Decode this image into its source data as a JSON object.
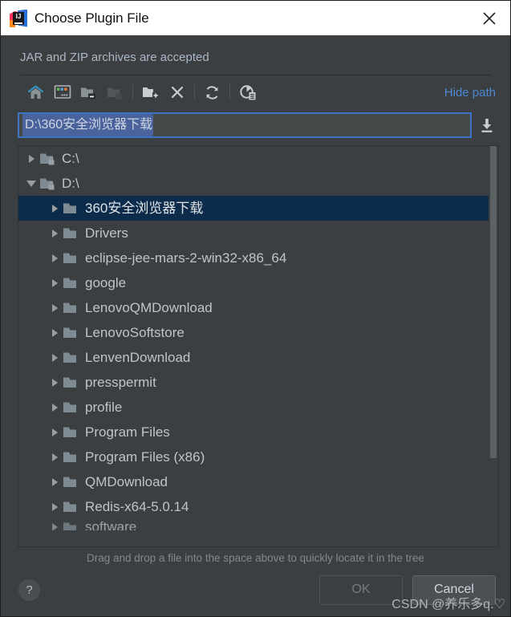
{
  "window": {
    "title": "Choose Plugin File",
    "app_icon": "intellij-idea-icon",
    "close_icon": "close-icon",
    "subtitle": "JAR and ZIP archives are accepted"
  },
  "toolbar": {
    "items": [
      {
        "name": "home-icon",
        "tooltip": "Home",
        "disabled": false
      },
      {
        "name": "desktop-icon",
        "tooltip": "Desktop",
        "disabled": false
      },
      {
        "name": "collapse-folder-icon",
        "tooltip": "Collapse",
        "disabled": false
      },
      {
        "name": "expand-folder-icon",
        "tooltip": "Expand",
        "disabled": true
      },
      {
        "name": "new-folder-icon",
        "tooltip": "New Folder",
        "disabled": false
      },
      {
        "name": "delete-icon",
        "tooltip": "Delete",
        "disabled": false
      },
      {
        "name": "refresh-icon",
        "tooltip": "Refresh",
        "disabled": false
      },
      {
        "name": "show-hidden-files-icon",
        "tooltip": "Show Hidden Files",
        "disabled": false
      }
    ],
    "hide_path_label": "Hide path"
  },
  "path_field": {
    "value": "D:\\360安全浏览器下载",
    "placeholder": "",
    "selected": true,
    "download_icon": "download-arrow-icon"
  },
  "tree": {
    "rows": [
      {
        "label": "C:\\",
        "level": 1,
        "expanded": false,
        "selected": false,
        "icon": "locked-drive-folder-icon",
        "clipped": false
      },
      {
        "label": "D:\\",
        "level": 1,
        "expanded": true,
        "selected": false,
        "icon": "locked-drive-folder-icon",
        "clipped": false
      },
      {
        "label": "360安全浏览器下载",
        "level": 2,
        "expanded": false,
        "selected": true,
        "icon": "folder-icon",
        "clipped": false
      },
      {
        "label": "Drivers",
        "level": 2,
        "expanded": false,
        "selected": false,
        "icon": "folder-icon",
        "clipped": false
      },
      {
        "label": "eclipse-jee-mars-2-win32-x86_64",
        "level": 2,
        "expanded": false,
        "selected": false,
        "icon": "folder-icon",
        "clipped": false
      },
      {
        "label": "google",
        "level": 2,
        "expanded": false,
        "selected": false,
        "icon": "folder-icon",
        "clipped": false
      },
      {
        "label": "LenovoQMDownload",
        "level": 2,
        "expanded": false,
        "selected": false,
        "icon": "folder-icon",
        "clipped": false
      },
      {
        "label": "LenovoSoftstore",
        "level": 2,
        "expanded": false,
        "selected": false,
        "icon": "folder-icon",
        "clipped": false
      },
      {
        "label": "LenvenDownload",
        "level": 2,
        "expanded": false,
        "selected": false,
        "icon": "folder-icon",
        "clipped": false
      },
      {
        "label": "presspermit",
        "level": 2,
        "expanded": false,
        "selected": false,
        "icon": "folder-icon",
        "clipped": false
      },
      {
        "label": "profile",
        "level": 2,
        "expanded": false,
        "selected": false,
        "icon": "folder-icon",
        "clipped": false
      },
      {
        "label": "Program Files",
        "level": 2,
        "expanded": false,
        "selected": false,
        "icon": "folder-icon",
        "clipped": false
      },
      {
        "label": "Program Files (x86)",
        "level": 2,
        "expanded": false,
        "selected": false,
        "icon": "folder-icon",
        "clipped": false
      },
      {
        "label": "QMDownload",
        "level": 2,
        "expanded": false,
        "selected": false,
        "icon": "folder-icon",
        "clipped": false
      },
      {
        "label": "Redis-x64-5.0.14",
        "level": 2,
        "expanded": false,
        "selected": false,
        "icon": "folder-icon",
        "clipped": false
      },
      {
        "label": "software",
        "level": 2,
        "expanded": false,
        "selected": false,
        "icon": "folder-icon",
        "clipped": true
      }
    ],
    "scrollbar": {
      "name": "vertical-scrollbar",
      "thumb_top_pct": 0,
      "thumb_height_pct": 78
    }
  },
  "hint": "Drag and drop a file into the space above to quickly locate it in the tree",
  "buttons": {
    "help_label": "?",
    "ok_label": "OK",
    "ok_disabled": true,
    "cancel_label": "Cancel"
  },
  "watermark": "CSDN @养乐多q.♡",
  "colors": {
    "dialog_bg": "#3c3f41",
    "titlebar_bg": "#ffffff",
    "accent_link": "#4d88d4",
    "selection_row": "#0d2c4b",
    "text_selection": "#4a639d",
    "focus_border": "#3b74c4",
    "label_text": "#bfc4c7",
    "folder_icon": "#7f8b93"
  }
}
